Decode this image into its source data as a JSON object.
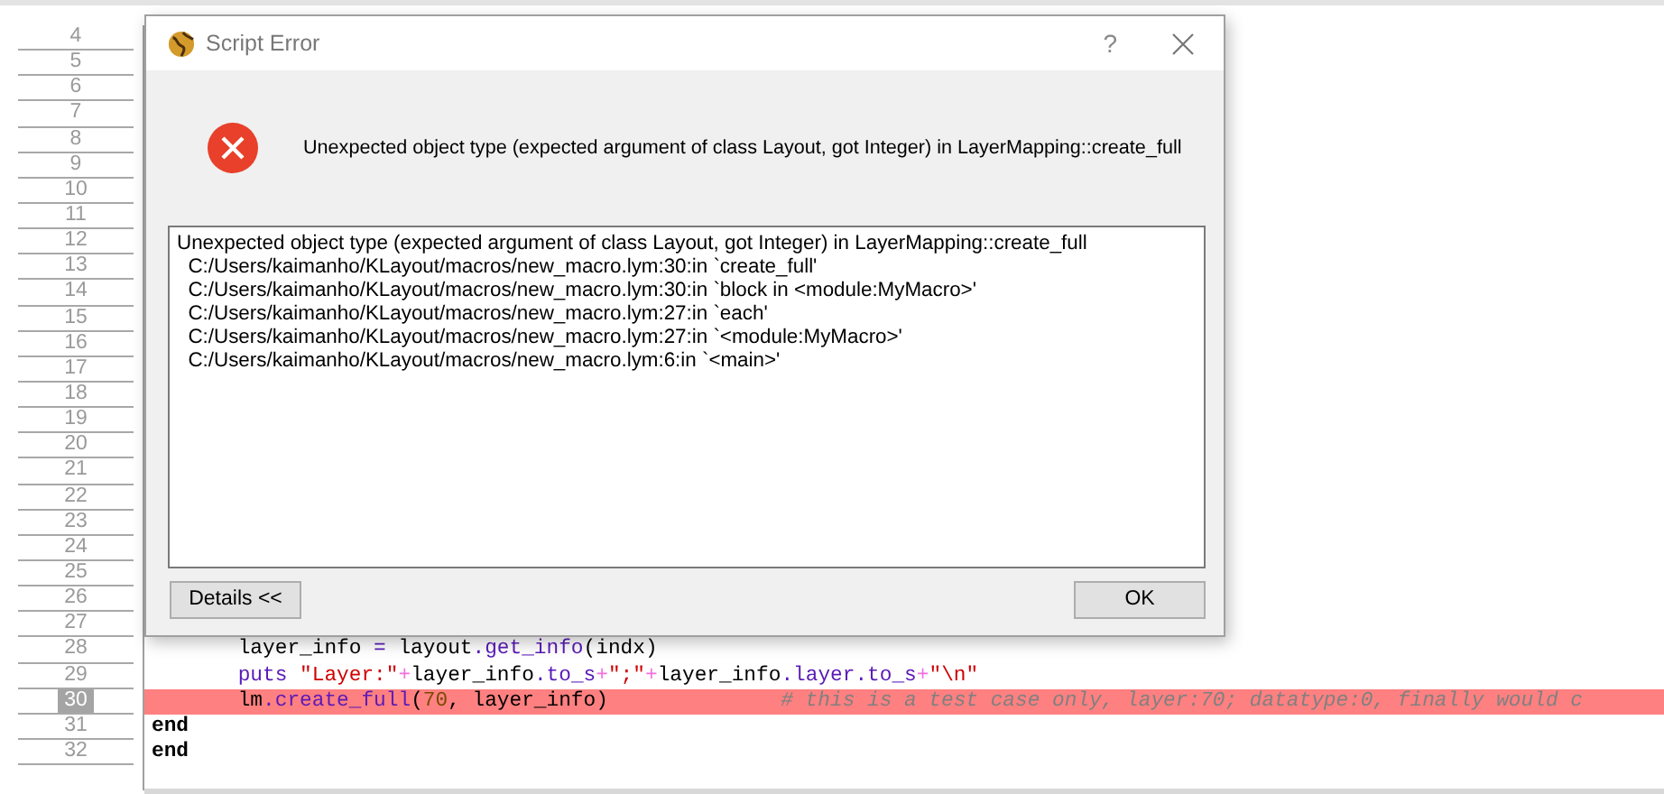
{
  "editor": {
    "gutter": [
      {
        "number": "4",
        "current": false
      },
      {
        "number": "5",
        "current": false
      },
      {
        "number": "6",
        "current": false
      },
      {
        "number": "7",
        "current": false
      },
      {
        "number": "8",
        "current": false
      },
      {
        "number": "9",
        "current": false
      },
      {
        "number": "10",
        "current": false
      },
      {
        "number": "11",
        "current": false
      },
      {
        "number": "12",
        "current": false
      },
      {
        "number": "13",
        "current": false
      },
      {
        "number": "14",
        "current": false
      },
      {
        "number": "15",
        "current": false
      },
      {
        "number": "16",
        "current": false
      },
      {
        "number": "17",
        "current": false
      },
      {
        "number": "18",
        "current": false
      },
      {
        "number": "19",
        "current": false
      },
      {
        "number": "20",
        "current": false
      },
      {
        "number": "21",
        "current": false
      },
      {
        "number": "22",
        "current": false
      },
      {
        "number": "23",
        "current": false
      },
      {
        "number": "24",
        "current": false
      },
      {
        "number": "25",
        "current": false
      },
      {
        "number": "26",
        "current": false
      },
      {
        "number": "27",
        "current": false
      },
      {
        "number": "28",
        "current": false
      },
      {
        "number": "29",
        "current": false
      },
      {
        "number": "30",
        "current": true
      },
      {
        "number": "31",
        "current": false
      },
      {
        "number": "32",
        "current": false
      }
    ],
    "code_lines": [
      {
        "error": false,
        "tokens": [
          {
            "kind": "plain",
            "text": "       layer_info "
          },
          {
            "kind": "method",
            "text": "="
          },
          {
            "kind": "plain",
            "text": " layout"
          },
          {
            "kind": "method",
            "text": ".get_info"
          },
          {
            "kind": "plain",
            "text": "(indx)"
          }
        ]
      },
      {
        "error": false,
        "tokens": [
          {
            "kind": "method",
            "text": "       puts"
          },
          {
            "kind": "string",
            "text": " \"Layer:\""
          },
          {
            "kind": "op",
            "text": "+"
          },
          {
            "kind": "plain",
            "text": "layer_info"
          },
          {
            "kind": "method",
            "text": ".to_s"
          },
          {
            "kind": "op",
            "text": "+"
          },
          {
            "kind": "string",
            "text": "\";\""
          },
          {
            "kind": "op",
            "text": "+"
          },
          {
            "kind": "plain",
            "text": "layer_info"
          },
          {
            "kind": "method",
            "text": ".layer.to_s"
          },
          {
            "kind": "op",
            "text": "+"
          },
          {
            "kind": "string",
            "text": "\"\\n\""
          }
        ]
      },
      {
        "error": true,
        "tokens": [
          {
            "kind": "plain",
            "text": "       lm"
          },
          {
            "kind": "method",
            "text": ".create_full"
          },
          {
            "kind": "plain",
            "text": "("
          },
          {
            "kind": "number",
            "text": "70"
          },
          {
            "kind": "plain",
            "text": ", layer_info)              "
          },
          {
            "kind": "comment",
            "text": "# this is a test case only, layer:70; datatype:0, finally would c"
          }
        ]
      },
      {
        "error": false,
        "tokens": [
          {
            "kind": "keyword",
            "text": "end"
          }
        ]
      },
      {
        "error": false,
        "tokens": [
          {
            "kind": "keyword",
            "text": "end"
          }
        ]
      }
    ]
  },
  "dialog": {
    "title": "Script Error",
    "help": "?",
    "message": "Unexpected object type (expected argument of class Layout, got Integer) in LayerMapping::create_full",
    "details": [
      "Unexpected object type (expected argument of class Layout, got Integer) in LayerMapping::create_full",
      "  C:/Users/kaimanho/KLayout/macros/new_macro.lym:30:in `create_full'",
      "  C:/Users/kaimanho/KLayout/macros/new_macro.lym:30:in `block in <module:MyMacro>'",
      "  C:/Users/kaimanho/KLayout/macros/new_macro.lym:27:in `each'",
      "  C:/Users/kaimanho/KLayout/macros/new_macro.lym:27:in `<module:MyMacro>'",
      "  C:/Users/kaimanho/KLayout/macros/new_macro.lym:6:in `<main>'"
    ],
    "details_button": "Details <<",
    "ok_button": "OK"
  }
}
